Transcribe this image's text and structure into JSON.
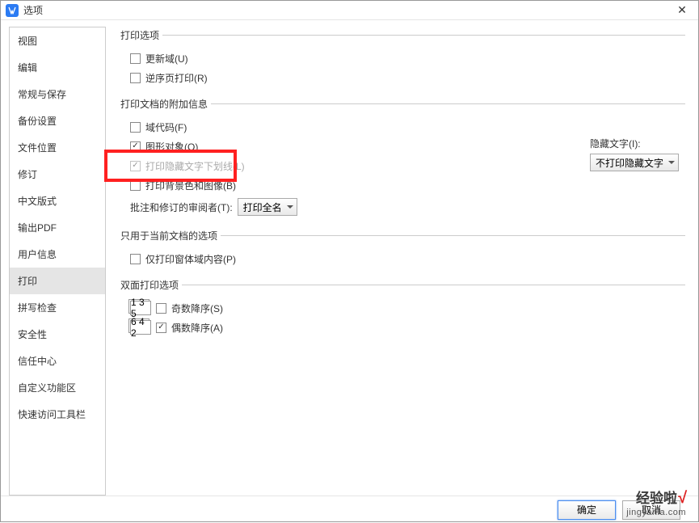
{
  "titlebar": {
    "title": "选项"
  },
  "sidebar": {
    "items": [
      {
        "label": "视图"
      },
      {
        "label": "编辑"
      },
      {
        "label": "常规与保存"
      },
      {
        "label": "备份设置"
      },
      {
        "label": "文件位置"
      },
      {
        "label": "修订"
      },
      {
        "label": "中文版式"
      },
      {
        "label": "输出PDF"
      },
      {
        "label": "用户信息"
      },
      {
        "label": "打印"
      },
      {
        "label": "拼写检查"
      },
      {
        "label": "安全性"
      },
      {
        "label": "信任中心"
      },
      {
        "label": "自定义功能区"
      },
      {
        "label": "快速访问工具栏"
      }
    ]
  },
  "groups": {
    "print_options": {
      "legend": "打印选项",
      "update_fields": "更新域(U)",
      "reverse_print": "逆序页打印(R)"
    },
    "additional": {
      "legend": "打印文档的附加信息",
      "field_codes": "域代码(F)",
      "graphics_objects": "图形对象(O)",
      "hidden_underline": "打印隐藏文字下划线(L)",
      "background": "打印背景色和图像(B)",
      "reviewer_label": "批注和修订的审阅者(T):",
      "reviewer_select": "打印全名",
      "hidden_text_label": "隐藏文字(I):",
      "hidden_text_select": "不打印隐藏文字"
    },
    "current_doc": {
      "legend": "只用于当前文档的选项",
      "form_only": "仅打印窗体域内容(P)"
    },
    "duplex": {
      "legend": "双面打印选项",
      "odd_icon": "1 3 5",
      "odd_label": "奇数降序(S)",
      "even_icon": "6 4 2",
      "even_label": "偶数降序(A)"
    }
  },
  "footer": {
    "ok": "确定",
    "cancel": "取消"
  },
  "watermark": {
    "line1": "经验啦",
    "line2": "jingyanla.com"
  }
}
